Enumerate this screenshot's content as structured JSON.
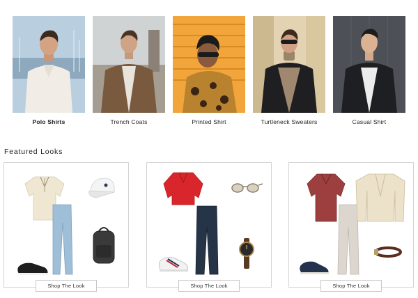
{
  "categories": [
    {
      "label": "Polo Shirts",
      "active": true
    },
    {
      "label": "Trench Coats",
      "active": false
    },
    {
      "label": "Printed Shirt",
      "active": false
    },
    {
      "label": "Turtleneck Sweaters",
      "active": false
    },
    {
      "label": "Casual Shirt",
      "active": false
    }
  ],
  "featured": {
    "title": "Featured Looks",
    "looks": [
      {
        "button": "Shop The Look",
        "items": [
          "cream-polo",
          "light-wash-jeans",
          "white-cap",
          "black-backpack",
          "black-sneakers"
        ]
      },
      {
        "button": "Shop The Look",
        "items": [
          "red-polo",
          "dark-jeans",
          "sunglasses",
          "watch",
          "white-sneakers"
        ]
      },
      {
        "button": "Shop The Look",
        "items": [
          "burgundy-polo",
          "stone-chinos",
          "beige-cardigan",
          "brown-belt",
          "navy-boat-shoes"
        ]
      }
    ]
  },
  "colors": {
    "border": "#d3d3d3",
    "text": "#1a1a1a"
  }
}
